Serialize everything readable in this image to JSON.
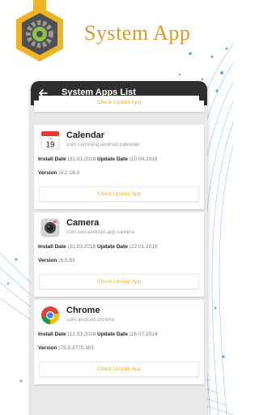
{
  "promo": {
    "title": "System App"
  },
  "app_bar": {
    "title": "System Apps List"
  },
  "labels": {
    "install_date": "Install Date :",
    "update_date": "Update Date :",
    "version": "Version :"
  },
  "partial_card": {
    "button_label": "Check Update App"
  },
  "apps": [
    {
      "name": "Calendar",
      "package": "com.samsung.android.calendar",
      "install_date": "31.03.2018",
      "update_date": "10.04.2018",
      "version": "4.2.14.3",
      "button_label": "Check Update App",
      "icon": "calendar-icon",
      "icon_day_label": "Tue",
      "icon_day_number": "19"
    },
    {
      "name": "Camera",
      "package": "com.sec.android.app.camera",
      "install_date": "31.03.2018",
      "update_date": "22.01.2019",
      "version": "6.5.83",
      "button_label": "Check Update App",
      "icon": "camera-icon"
    },
    {
      "name": "Chrome",
      "package": "com.android.chrome",
      "install_date": "12.03.2018",
      "update_date": "16.07.2019",
      "version": "75.0.3770.101",
      "button_label": "Check Update App",
      "icon": "chrome-icon"
    }
  ],
  "colors": {
    "accent": "#f1b31c",
    "app_bar": "#2e2e2e",
    "title_gold": "#d89a2a",
    "swoosh_blue": "#2a7fd0"
  }
}
